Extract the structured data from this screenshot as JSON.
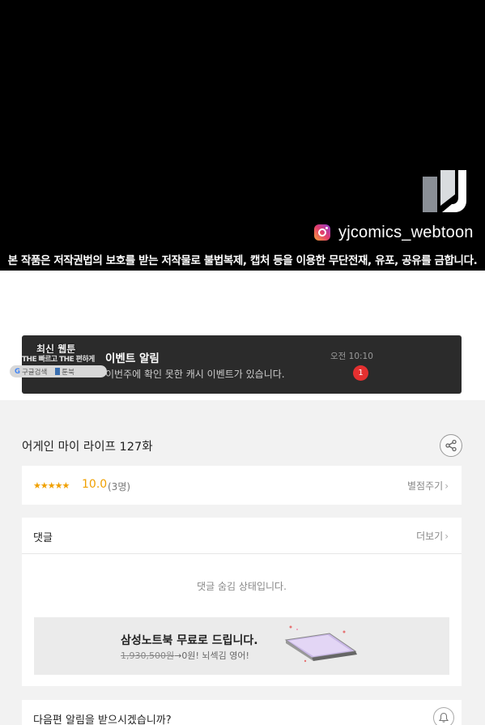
{
  "banner": {
    "instagram_handle": "yjcomics_webtoon",
    "copyright_notice": "본 작품은 저작권법의 보호를 받는 저작물로 불법복제, 캡처 등을 이용한 무단전재, 유포, 공유를 금합니다."
  },
  "notification": {
    "overlay_title": "최신 웹툰",
    "overlay_subtitle": "THE 빠르고 THE 편하게",
    "overlay_pill_search": "구글검색",
    "overlay_pill_brand": "툰북",
    "title": "이벤트 알림",
    "body": "이번주에 확인 못한 캐시 이벤트가 있습니다.",
    "time": "오전 10:10",
    "badge_count": "1",
    "badge_color": "#e53030"
  },
  "episode": {
    "title": "어게인 마이 라이프 127화"
  },
  "rating": {
    "stars": "★★★★★",
    "score": "10.0",
    "count": "(3명)",
    "give_rating_label": "별점주기"
  },
  "comments": {
    "title": "댓글",
    "more_label": "더보기",
    "hidden_message": "댓글 숨김 상태입니다."
  },
  "ad": {
    "title": "삼성노트북 무료로 드립니다.",
    "price_original": "1,930,500원",
    "price_rest": "→0원! 뇌섹김 영어!"
  },
  "next_episode": {
    "question": "다음편 알림을 받으시겠습니까?"
  },
  "icons": {
    "chevron": "›",
    "share": "share-icon",
    "bell": "bell-icon"
  },
  "colors": {
    "accent_star": "#f0a000",
    "banner_bg": "#000000",
    "notification_bg": "#2b2b2b"
  }
}
